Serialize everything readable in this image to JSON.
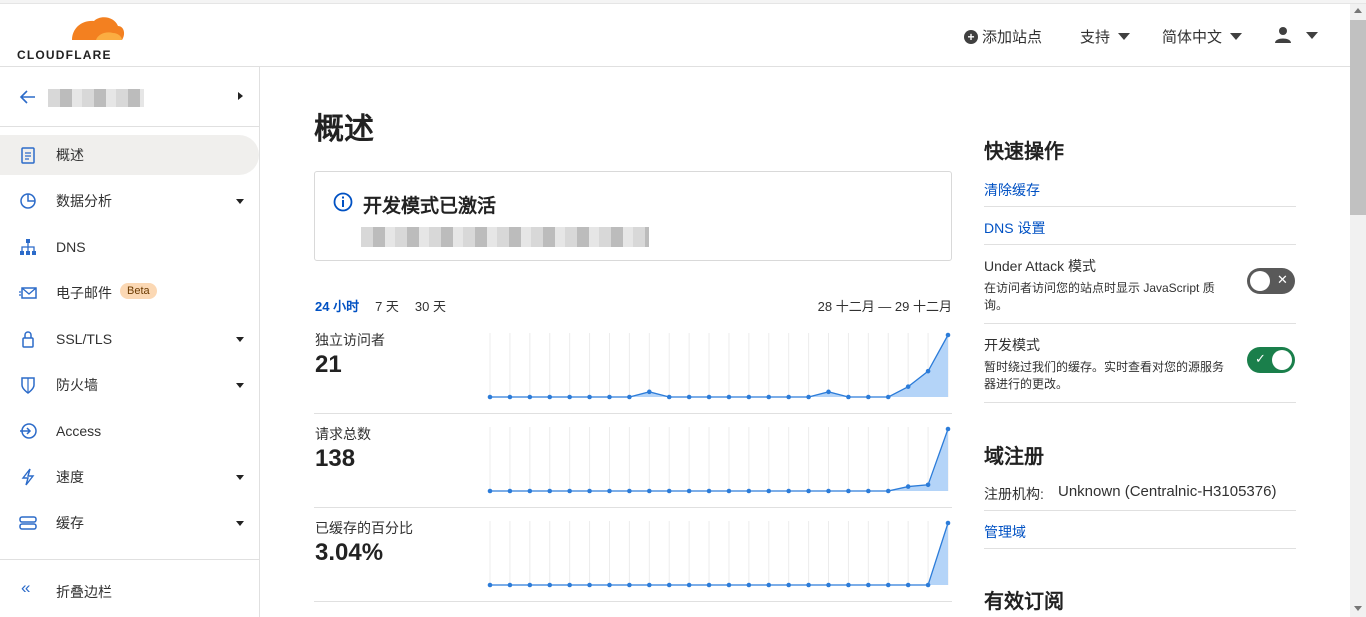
{
  "header": {
    "logo_text": "CLOUDFLARE",
    "add_site": "添加站点",
    "support": "支持",
    "language": "简体中文"
  },
  "sidebar": {
    "items": [
      {
        "label": "概述",
        "icon": "clipboard-icon",
        "active": true,
        "caret": false
      },
      {
        "label": "数据分析",
        "icon": "pie-chart-icon",
        "active": false,
        "caret": true
      },
      {
        "label": "DNS",
        "icon": "network-icon",
        "active": false,
        "caret": false
      },
      {
        "label": "电子邮件",
        "icon": "email-icon",
        "active": false,
        "caret": false,
        "badge": "Beta"
      },
      {
        "label": "SSL/TLS",
        "icon": "lock-icon",
        "active": false,
        "caret": true
      },
      {
        "label": "防火墙",
        "icon": "shield-icon",
        "active": false,
        "caret": true
      },
      {
        "label": "Access",
        "icon": "access-icon",
        "active": false,
        "caret": false
      },
      {
        "label": "速度",
        "icon": "lightning-icon",
        "active": false,
        "caret": true
      },
      {
        "label": "缓存",
        "icon": "storage-icon",
        "active": false,
        "caret": true
      }
    ],
    "collapse_label": "折叠边栏"
  },
  "main": {
    "title": "概述",
    "alert_title": "开发模式已激活",
    "tabs": [
      "24 小时",
      "7 天",
      "30 天"
    ],
    "active_tab": "24 小时",
    "date_range": "28 十二月 — 29 十二月",
    "metrics": [
      {
        "label": "独立访问者",
        "value": "21"
      },
      {
        "label": "请求总数",
        "value": "138"
      },
      {
        "label": "已缓存的百分比",
        "value": "3.04%"
      }
    ]
  },
  "quick_actions": {
    "title": "快速操作",
    "purge_cache": "清除缓存",
    "dns_settings": "DNS 设置",
    "under_attack_title": "Under Attack 模式",
    "under_attack_desc": "在访问者访问您的站点时显示 JavaScript 质询。",
    "under_attack_on": false,
    "dev_mode_title": "开发模式",
    "dev_mode_desc": "暂时绕过我们的缓存。实时查看对您的源服务器进行的更改。",
    "dev_mode_on": true
  },
  "domain_registration": {
    "title": "域注册",
    "registrar_label": "注册机构:",
    "registrar_value": "Unknown (Centralnic-H3105376)",
    "manage_link": "管理域"
  },
  "subscriptions": {
    "title": "有效订阅"
  },
  "chart_data": [
    {
      "type": "area",
      "series": [
        {
          "values": [
            0,
            0,
            0,
            0,
            0,
            0,
            0,
            0,
            1,
            0,
            0,
            0,
            0,
            0,
            0,
            0,
            0,
            1,
            0,
            0,
            0,
            2,
            5,
            12
          ]
        }
      ]
    },
    {
      "type": "area",
      "series": [
        {
          "values": [
            0,
            0,
            0,
            0,
            0,
            0,
            0,
            0,
            0,
            0,
            0,
            0,
            0,
            0,
            0,
            0,
            0,
            0,
            0,
            0,
            0,
            5,
            7,
            70
          ]
        }
      ]
    },
    {
      "type": "area",
      "series": [
        {
          "values": [
            0,
            0,
            0,
            0,
            0,
            0,
            0,
            0,
            0,
            0,
            0,
            0,
            0,
            0,
            0,
            0,
            0,
            0,
            0,
            0,
            0,
            0,
            0,
            3.04
          ]
        }
      ]
    }
  ],
  "colors": {
    "accent": "#0051c3",
    "chart_line": "#2c7cd9",
    "chart_fill": "#b4d4f8",
    "toggle_on": "#1a7f4b",
    "toggle_off": "#595959",
    "logo_orange": "#f38020"
  }
}
